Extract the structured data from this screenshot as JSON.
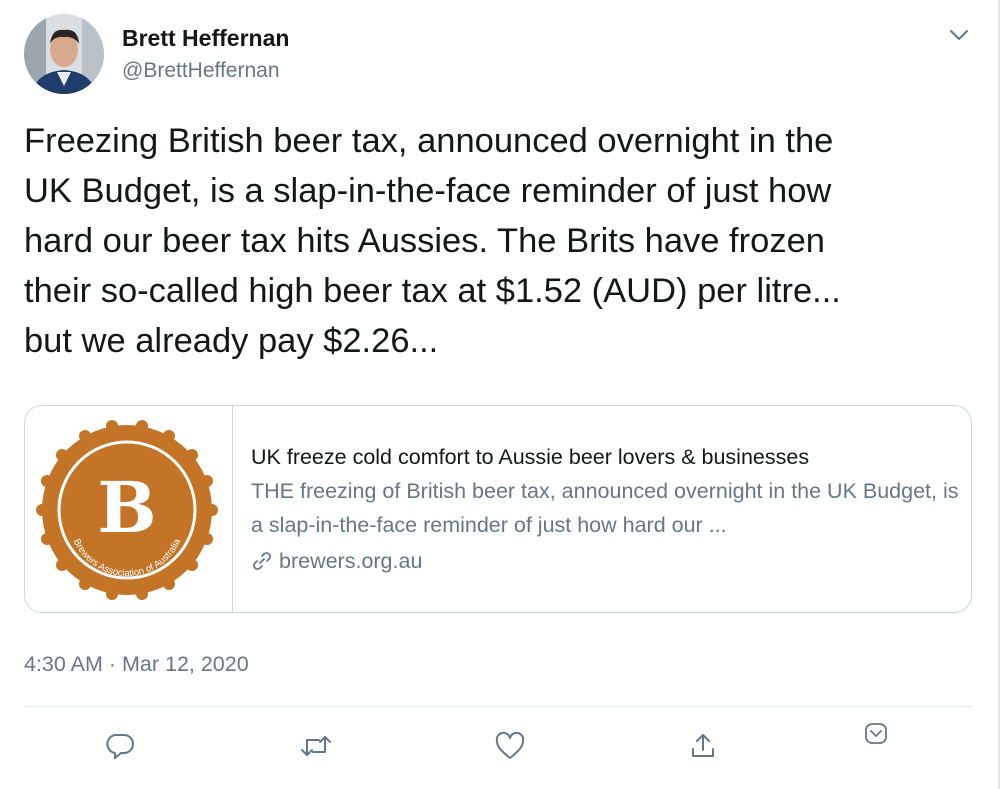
{
  "author": {
    "name": "Brett Heffernan",
    "handle": "@BrettHeffernan"
  },
  "tweet": {
    "text": "Freezing British beer tax, announced overnight in the\nUK Budget, is a slap-in-the-face reminder of just how\nhard our beer tax hits Aussies. The Brits have frozen\ntheir so-called high beer tax at $1.52 (AUD) per litre...\nbut we already pay $2.26...",
    "timestamp": "4:30 AM · Mar 12, 2020"
  },
  "card": {
    "logo_letter": "B",
    "logo_ring_text": "Brewers Association of Australia",
    "title": "UK freeze cold comfort to Aussie beer lovers & businesses",
    "description": "THE freezing of British beer tax, announced overnight in the UK Budget, is a slap-in-the-face reminder of just how hard our ...",
    "domain": "brewers.org.au"
  },
  "actions": [
    {
      "name": "reply",
      "icon": "reply-icon"
    },
    {
      "name": "retweet",
      "icon": "retweet-icon"
    },
    {
      "name": "like",
      "icon": "heart-icon"
    },
    {
      "name": "share",
      "icon": "share-icon"
    },
    {
      "name": "menu",
      "icon": "chevron-down-icon"
    }
  ],
  "colors": {
    "text": "#14171a",
    "secondary": "#657786",
    "accent": "#1da1f2",
    "border": "#ccd6dd",
    "logo_orange": "#c47427"
  }
}
